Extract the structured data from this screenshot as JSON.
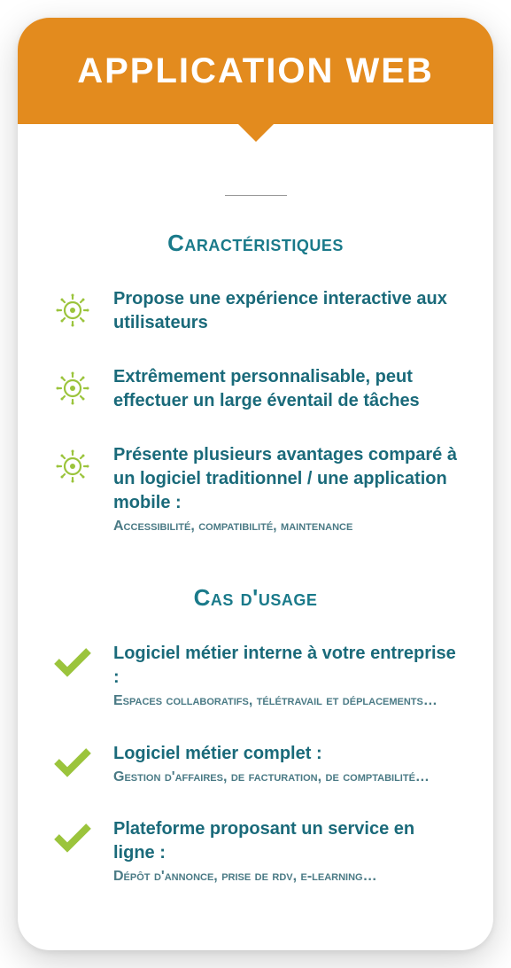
{
  "header": {
    "title": "APPLICATION WEB"
  },
  "section1": {
    "title": "Caractéristiques",
    "items": [
      {
        "title": "Propose une expérience interactive aux utilisateurs",
        "sub": ""
      },
      {
        "title": "Extrêmement personnalisable, peut effectuer un large éventail de tâches",
        "sub": ""
      },
      {
        "title": "Présente plusieurs avantages comparé à un logiciel traditionnel / une application mobile :",
        "sub": "Accessibilité, compatibilité, maintenance"
      }
    ]
  },
  "section2": {
    "title": "Cas d'usage",
    "items": [
      {
        "title": "Logiciel métier interne à votre entreprise :",
        "sub": "Espaces collaboratifs, télétravail et déplacements…"
      },
      {
        "title": "Logiciel métier complet :",
        "sub": "Gestion d'affaires, de facturation, de comptabilité…"
      },
      {
        "title": "Plateforme proposant un service en ligne :",
        "sub": "Dépôt d'annonce, prise de rdv, e-learning…"
      }
    ]
  }
}
